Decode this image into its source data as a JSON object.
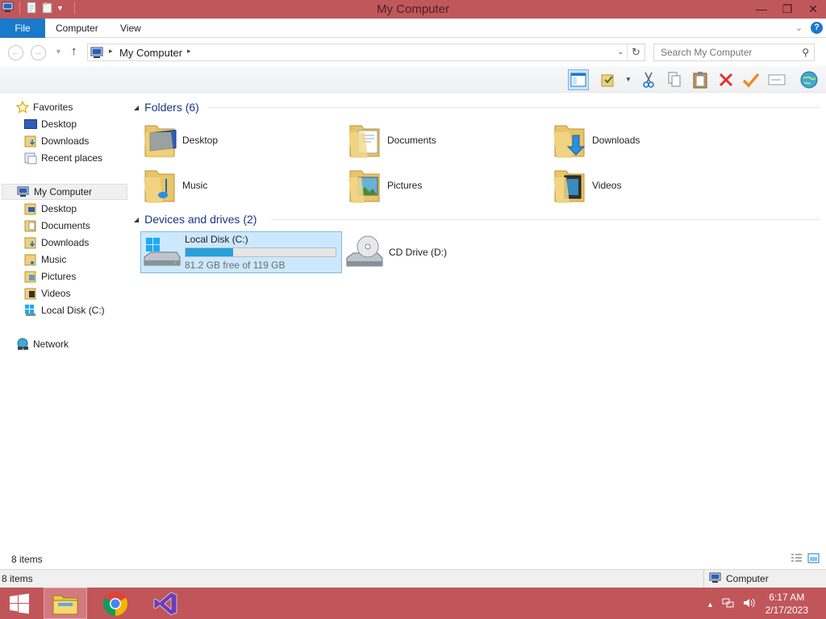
{
  "window": {
    "title": "My Computer"
  },
  "ribbon": {
    "tabs": [
      {
        "label": "File"
      },
      {
        "label": "Computer"
      },
      {
        "label": "View"
      }
    ],
    "help_label": "?"
  },
  "address": {
    "breadcrumb": "My Computer",
    "refresh_icon": "refresh-icon"
  },
  "search": {
    "placeholder": "Search My Computer"
  },
  "toolbar": {
    "icons": [
      "preview-pane-icon",
      "properties-icon",
      "cut-icon",
      "copy-icon",
      "paste-icon",
      "delete-icon",
      "checkmark-icon",
      "rename-icon",
      "globe-icon"
    ]
  },
  "sidebar": {
    "favorites_label": "Favorites",
    "favorites": [
      {
        "label": "Desktop"
      },
      {
        "label": "Downloads"
      },
      {
        "label": "Recent places"
      }
    ],
    "computer_label": "My Computer",
    "computer": [
      {
        "label": "Desktop"
      },
      {
        "label": "Documents"
      },
      {
        "label": "Downloads"
      },
      {
        "label": "Music"
      },
      {
        "label": "Pictures"
      },
      {
        "label": "Videos"
      },
      {
        "label": "Local Disk (C:)"
      }
    ],
    "network_label": "Network"
  },
  "main": {
    "folders_header": "Folders (6)",
    "folders": [
      {
        "label": "Desktop",
        "icon": "desktop-folder-icon"
      },
      {
        "label": "Documents",
        "icon": "documents-folder-icon"
      },
      {
        "label": "Downloads",
        "icon": "downloads-folder-icon"
      },
      {
        "label": "Music",
        "icon": "music-folder-icon"
      },
      {
        "label": "Pictures",
        "icon": "pictures-folder-icon"
      },
      {
        "label": "Videos",
        "icon": "videos-folder-icon"
      }
    ],
    "drives_header": "Devices and drives (2)",
    "drives": [
      {
        "label": "Local Disk (C:)",
        "free_text": "81.2 GB free of 119 GB",
        "used_fraction": 0.318,
        "icon": "hard-drive-icon"
      },
      {
        "label": "CD Drive (D:)",
        "icon": "cd-drive-icon"
      }
    ]
  },
  "status": {
    "item_count": "8 items",
    "outer_count": "8 items",
    "zone_label": "Computer"
  },
  "taskbar": {
    "time": "6:17 AM",
    "date": "2/17/2023",
    "apps": [
      "file-explorer-icon",
      "chrome-icon",
      "visual-studio-icon"
    ]
  },
  "colors": {
    "accent": "#1979ca",
    "titlebar": "#c0575b",
    "header_text": "#1e3287",
    "drive_fill": "#26a0da"
  }
}
